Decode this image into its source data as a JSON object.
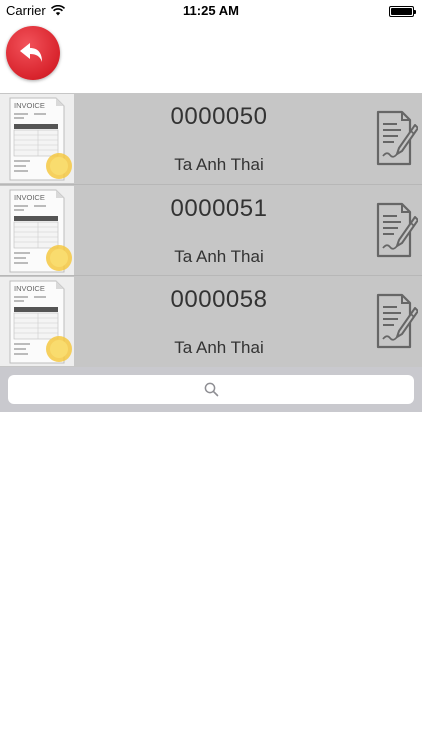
{
  "status_bar": {
    "carrier": "Carrier",
    "time": "11:25 AM",
    "wifi_icon": "wifi-icon",
    "battery_icon": "battery-icon",
    "battery_level": 1.0
  },
  "toolbar": {
    "back_icon": "back-arrow-icon",
    "back_color": "#d8232c"
  },
  "invoices": [
    {
      "number": "0000050",
      "name": "Ta Anh Thai",
      "thumbnail_icon": "invoice-document-icon",
      "action_icon": "sign-document-icon"
    },
    {
      "number": "0000051",
      "name": "Ta Anh Thai",
      "thumbnail_icon": "invoice-document-icon",
      "action_icon": "sign-document-icon"
    },
    {
      "number": "0000058",
      "name": "Ta Anh Thai",
      "thumbnail_icon": "invoice-document-icon",
      "action_icon": "sign-document-icon"
    }
  ],
  "thumbnail_label": "INVOICE",
  "search": {
    "placeholder": "",
    "value": "",
    "icon": "search-icon"
  },
  "colors": {
    "list_background": "#c6c6c6",
    "search_bar_background": "#c9c9ce",
    "seal": "#f5c842"
  }
}
